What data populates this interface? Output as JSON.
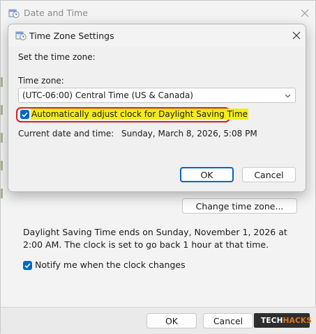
{
  "outer": {
    "title": "Date and Time",
    "change_tz_label": "Change time zone...",
    "dst_notice": "Daylight Saving Time ends on Sunday, November 1, 2026 at 2:00 AM. The clock is set to go back 1 hour at that time.",
    "notify_label": "Notify me when the clock changes",
    "notify_checked": true,
    "ok_label": "OK",
    "cancel_label": "Cancel"
  },
  "inner": {
    "title": "Time Zone Settings",
    "set_tz_heading": "Set the time zone:",
    "tz_label": "Time zone:",
    "tz_value": "(UTC-06:00) Central Time (US & Canada)",
    "auto_adjust_label": "Automatically adjust clock for Daylight Saving Time",
    "auto_adjust_checked": true,
    "current_label": "Current date and time:",
    "current_value": "Sunday, March 8, 2026, 5:08 PM",
    "ok_label": "OK",
    "cancel_label": "Cancel"
  },
  "watermark": {
    "part1": "TECH",
    "part2": "HACKS"
  },
  "colors": {
    "accent": "#0067c0",
    "highlight": "#f2ec1a",
    "annotation": "#d82020",
    "brand": "#e07a1f"
  }
}
